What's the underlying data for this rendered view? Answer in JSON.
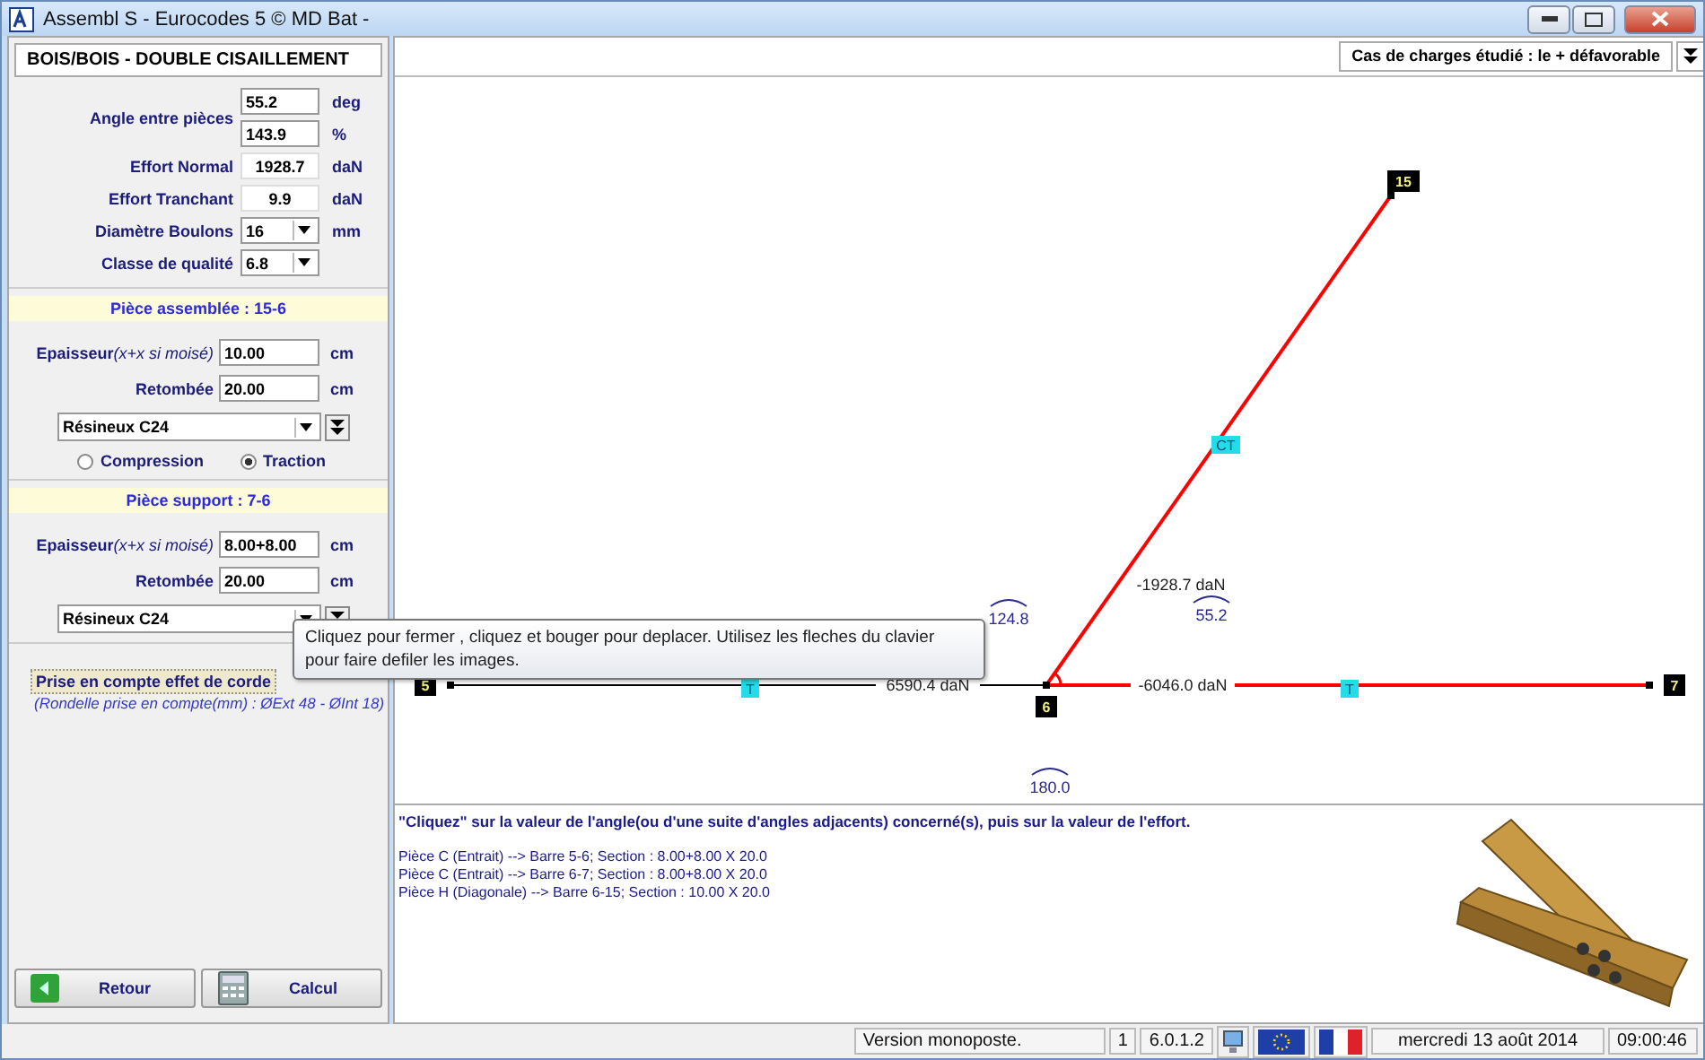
{
  "window": {
    "title": "Assembl S - Eurocodes 5 © MD Bat -"
  },
  "left_panel": {
    "header": "BOIS/BOIS - DOUBLE CISAILLEMENT",
    "angle": {
      "label": "Angle entre pièces",
      "fields": [
        {
          "value": "55.2",
          "unit": "deg"
        },
        {
          "value": "143.9",
          "unit": "%"
        }
      ]
    },
    "rows": [
      {
        "kind": "readout",
        "label": "Effort Normal",
        "value": "1928.7",
        "unit": "daN"
      },
      {
        "kind": "readout",
        "label": "Effort Tranchant",
        "value": "9.9",
        "unit": "daN"
      },
      {
        "kind": "dropdown",
        "label": "Diamètre Boulons",
        "value": "16",
        "unit": "mm"
      },
      {
        "kind": "dropdown",
        "label": "Classe de qualité",
        "value": "6.8"
      }
    ],
    "sections": [
      {
        "title": "Pièce assemblée : 15-6",
        "thickness_label": "Epaisseur",
        "thickness_hint": "(x+x si moisé)",
        "thickness": "10.00",
        "thickness_unit": "cm",
        "drop_label": "Retombée",
        "drop": "20.00",
        "drop_unit": "cm",
        "material": "Résineux C24",
        "radios": [
          {
            "label": "Compression",
            "selected": false
          },
          {
            "label": "Traction",
            "selected": true
          }
        ]
      },
      {
        "title": "Pièce support : 7-6",
        "thickness_label": "Epaisseur",
        "thickness_hint": "(x+x si moisé)",
        "thickness": "8.00+8.00",
        "thickness_unit": "cm",
        "drop_label": "Retombée",
        "drop": "20.00",
        "drop_unit": "cm",
        "material": "Résineux C24"
      }
    ],
    "rope_effect": {
      "button": "Prise en compte effet de corde",
      "note": "(Rondelle prise en compte(mm) : ØExt 48 - ØInt 18)"
    },
    "buttons": [
      {
        "kind": "back",
        "label": "Retour"
      },
      {
        "kind": "calc",
        "label": "Calcul"
      }
    ]
  },
  "load_case": "Cas de charges étudié : le + défavorable",
  "diagram": {
    "nodes": [
      {
        "label": "5"
      },
      {
        "label": "6"
      },
      {
        "label": "7"
      },
      {
        "label": "15"
      }
    ],
    "bars": [
      {
        "label": "CT",
        "force": "-1928.7 daN",
        "color": "#ff0000"
      },
      {
        "label": "T",
        "force": "6590.4 daN",
        "color": "#000000"
      },
      {
        "label": "T",
        "force": "-6046.0 daN",
        "color": "#ff0000"
      }
    ],
    "angles": [
      {
        "value": "124.8"
      },
      {
        "value": "55.2"
      },
      {
        "value": "180.0"
      }
    ]
  },
  "tooltip": "Cliquez pour fermer , cliquez et bouger pour deplacer. Utilisez les fleches du clavier pour faire defiler les images.",
  "instructions": "\"Cliquez\" sur la valeur de l'angle(ou d'une suite d'angles adjacents) concerné(s), puis sur la valeur de l'effort.",
  "pieces": [
    "Pièce C (Entrait) --> Barre 5-6; Section : 8.00+8.00 X 20.0",
    "Pièce C (Entrait) --> Barre 6-7; Section : 8.00+8.00 X 20.0",
    "Pièce H (Diagonale) --> Barre 6-15; Section : 10.00 X 20.0"
  ],
  "status_bar": {
    "version": "Version monoposte.",
    "count": "1",
    "build": "6.0.1.2",
    "date": "mercredi 13 août 2014",
    "time": "09:00:46"
  }
}
